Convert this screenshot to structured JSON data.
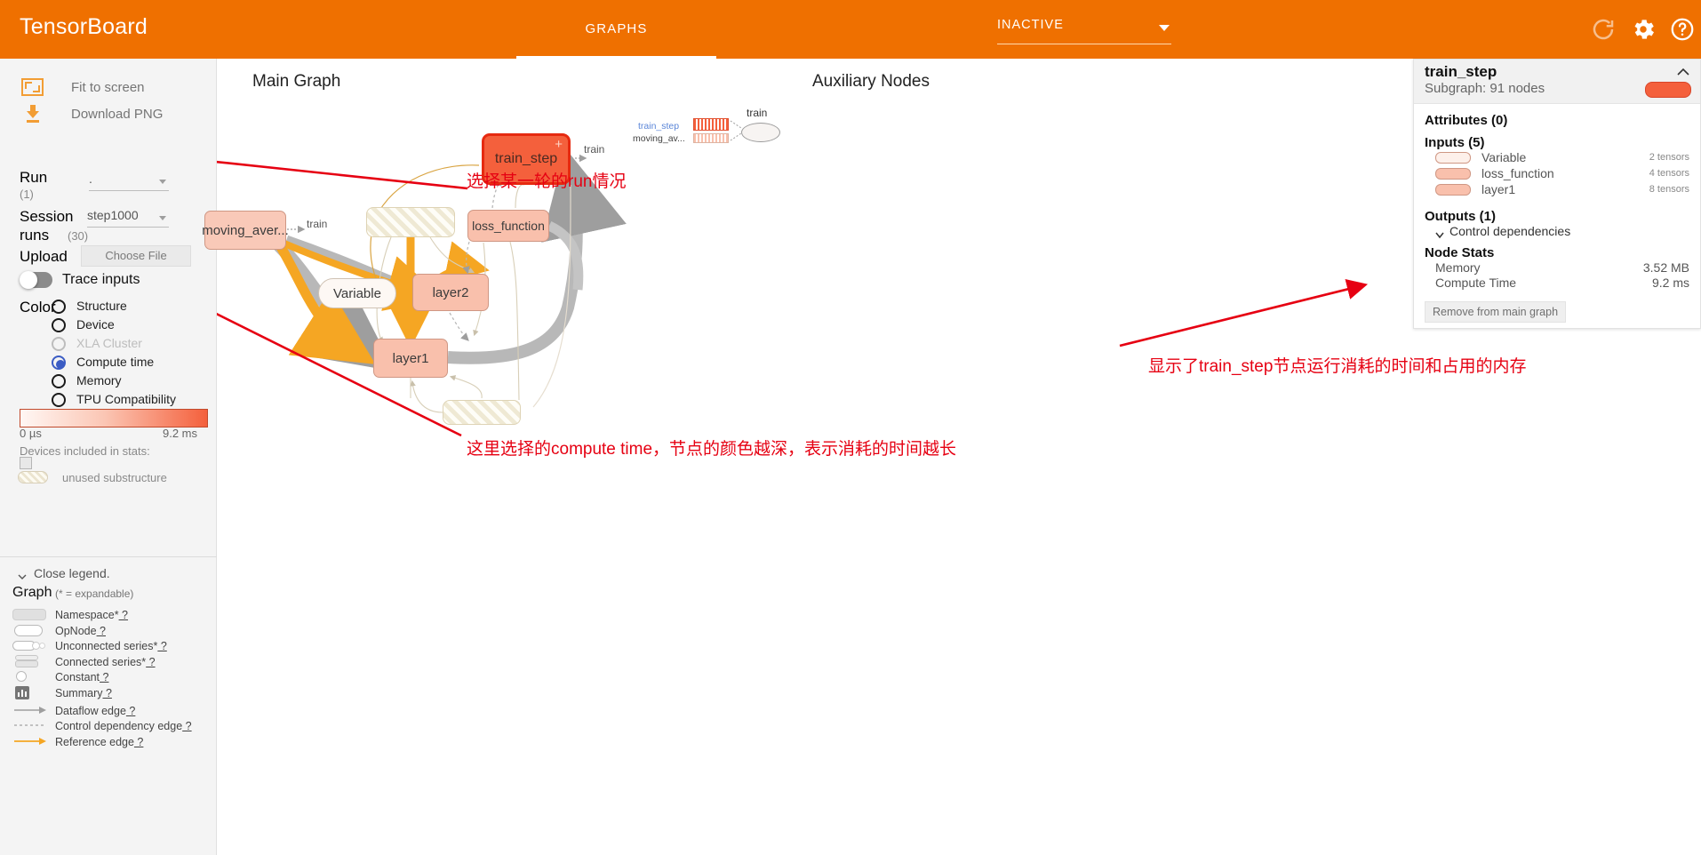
{
  "header": {
    "brand": "TensorBoard",
    "tabs": [
      {
        "label": "GRAPHS",
        "active": true
      }
    ],
    "inactive_label": "INACTIVE",
    "icons": [
      "reload-icon",
      "gear-icon",
      "help-icon"
    ]
  },
  "sidebar": {
    "fit_to_screen": "Fit to screen",
    "download_png": "Download PNG",
    "run_label": "Run",
    "run_count": "(1)",
    "run_value": ".",
    "session_label": "Session",
    "session_label2": "runs",
    "session_count": "(30)",
    "session_value": "step1000",
    "upload_label": "Upload",
    "choose_file": "Choose File",
    "trace_inputs": "Trace inputs",
    "color_label": "Color",
    "color_options": [
      {
        "label": "Structure",
        "state": "off"
      },
      {
        "label": "Device",
        "state": "off"
      },
      {
        "label": "XLA Cluster",
        "state": "disabled"
      },
      {
        "label": "Compute time",
        "state": "selected"
      },
      {
        "label": "Memory",
        "state": "off"
      },
      {
        "label": "TPU Compatibility",
        "state": "off"
      }
    ],
    "gradient_min": "0 µs",
    "gradient_max": "9.2 ms",
    "devices_label": "Devices included in stats:",
    "unused_substructure": "unused substructure",
    "close_legend": "Close legend.",
    "legend_title": "Graph",
    "legend_subtitle": "(* = expandable)",
    "legend_items": [
      {
        "label": "Namespace*",
        "help": "?",
        "sym": "namespace-icon"
      },
      {
        "label": "OpNode",
        "help": "?",
        "sym": "opnode-icon"
      },
      {
        "label": "Unconnected series*",
        "help": "?",
        "sym": "unconnected-series-icon"
      },
      {
        "label": "Connected series*",
        "help": "?",
        "sym": "connected-series-icon"
      },
      {
        "label": "Constant",
        "help": "?",
        "sym": "constant-icon"
      },
      {
        "label": "Summary",
        "help": "?",
        "sym": "summary-icon"
      },
      {
        "label": "Dataflow edge",
        "help": "?",
        "sym": "dataflow-edge-icon"
      },
      {
        "label": "Control dependency edge",
        "help": "?",
        "sym": "control-dependency-edge-icon"
      },
      {
        "label": "Reference edge",
        "help": "?",
        "sym": "reference-edge-icon"
      }
    ]
  },
  "canvas": {
    "main_graph_title": "Main Graph",
    "auxiliary_title": "Auxiliary Nodes",
    "nodes": {
      "train_step": "train_step",
      "train_step_expand": "+",
      "moving_aver": "moving_aver...",
      "loss_function": "loss_function",
      "variable": "Variable",
      "layer2": "layer2",
      "layer1": "layer1"
    },
    "edge_labels": {
      "train_main": "train",
      "train_left": "train"
    },
    "aux": {
      "train_step": "train_step",
      "moving_av": "moving_av...",
      "train": "train"
    },
    "annotations": {
      "run": "选择某一轮的run情况",
      "color": "这里选择的compute time，节点的颜色越深，表示消耗的时间越长",
      "stats": "显示了train_step节点运行消耗的时间和占用的内存"
    }
  },
  "info_panel": {
    "title": "train_step",
    "subtitle": "Subgraph: 91 nodes",
    "attributes_heading": "Attributes (0)",
    "inputs_heading": "Inputs (5)",
    "inputs": [
      {
        "name": "Variable",
        "tensors": "2 tensors",
        "color": "#fdf0ea"
      },
      {
        "name": "loss_function",
        "tensors": "4 tensors",
        "color": "#f9c0ac"
      },
      {
        "name": "layer1",
        "tensors": "8 tensors",
        "color": "#f9c0ac"
      }
    ],
    "outputs_heading": "Outputs (1)",
    "control_dependencies": "Control dependencies",
    "node_stats_heading": "Node Stats",
    "stats": [
      {
        "key": "Memory",
        "value": "3.52 MB"
      },
      {
        "key": "Compute Time",
        "value": "9.2 ms"
      }
    ],
    "remove_button": "Remove from main graph"
  },
  "colors": {
    "brand_orange": "#ef7000",
    "selected_node": "#f4603c",
    "node_pink": "#f9c0ac",
    "annotation_red": "#e60012",
    "radio_blue": "#3b5cc4"
  }
}
